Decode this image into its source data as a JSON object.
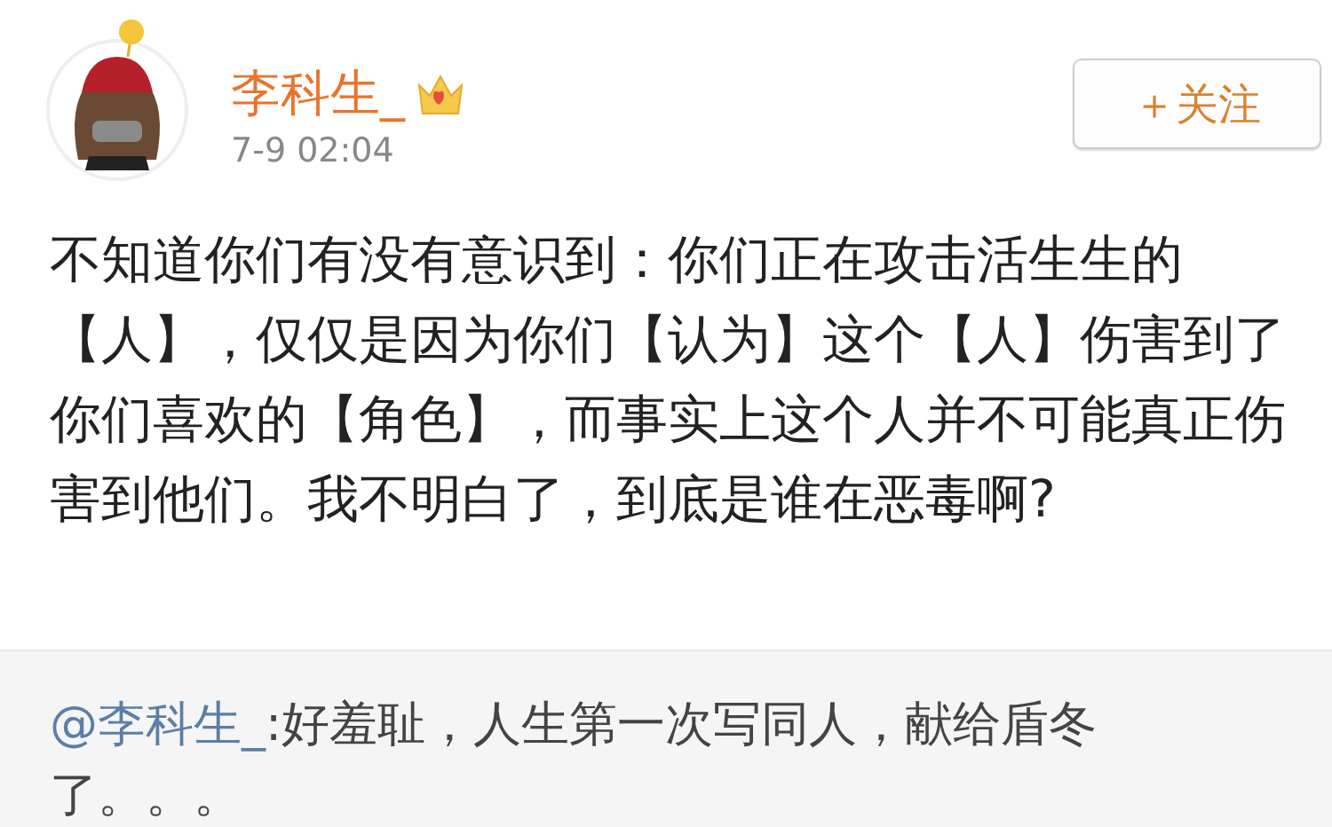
{
  "post": {
    "author": "李科生_",
    "time": "7-9 02:04",
    "follow_button": "＋关注",
    "text": "不知道你们有没有意识到：你们正在攻击活生生的【人】，仅仅是因为你们【认为】这个【人】伤害到了你们喜欢的【角色】，而事实上这个人并不可能真正伤害到他们。我不明白了，到底是谁在恶毒啊?"
  },
  "repost": {
    "mention": "@李科生_",
    "text": ":好羞耻，人生第一次写同人，献给盾冬了。。。"
  }
}
